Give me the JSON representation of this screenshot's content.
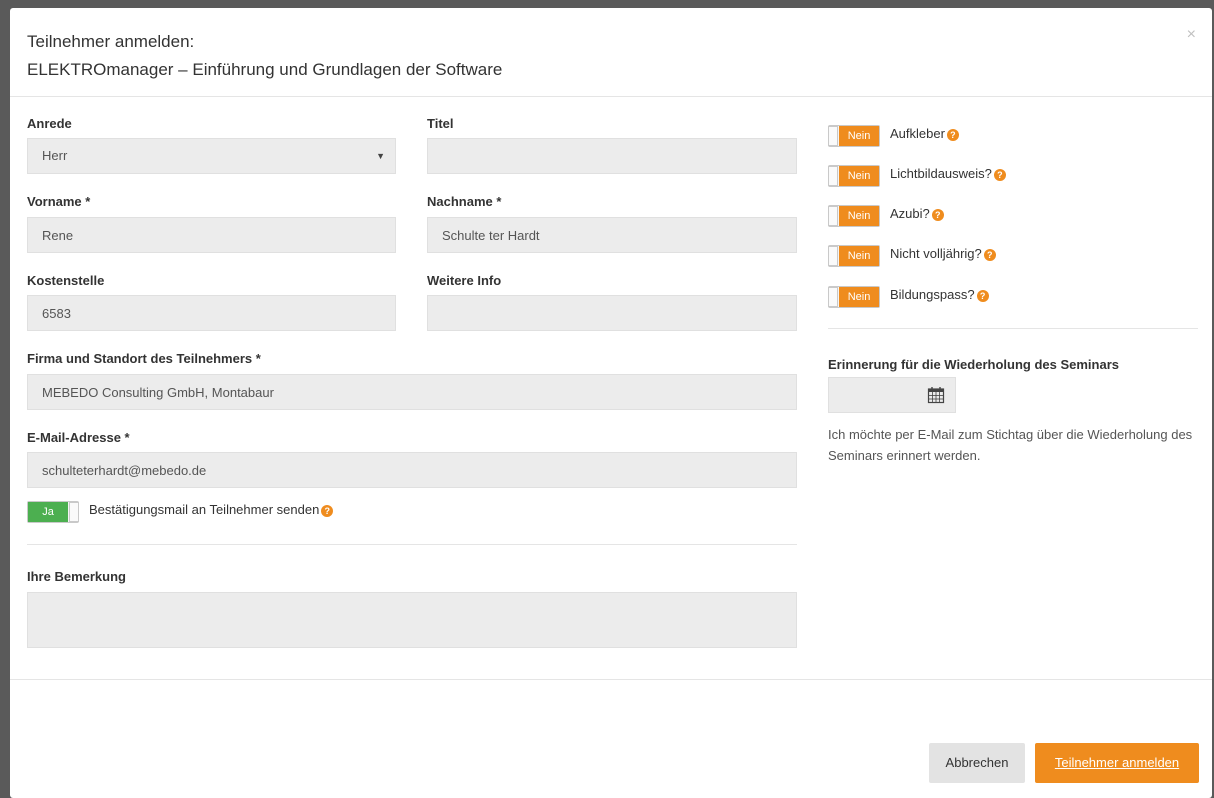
{
  "header": {
    "title_line1": "Teilnehmer anmelden:",
    "title_line2": "ELEKTROmanager – Einführung und Grundlagen der Software",
    "close": "×"
  },
  "form": {
    "anrede": {
      "label": "Anrede",
      "value": "Herr"
    },
    "titel": {
      "label": "Titel",
      "value": ""
    },
    "vorname": {
      "label": "Vorname *",
      "value": "Rene"
    },
    "nachname": {
      "label": "Nachname *",
      "value": "Schulte ter Hardt"
    },
    "kostenstelle": {
      "label": "Kostenstelle",
      "value": "6583"
    },
    "weitere_info": {
      "label": "Weitere Info",
      "value": ""
    },
    "firma": {
      "label": "Firma und Standort des Teilnehmers *",
      "value": "MEBEDO Consulting GmbH, Montabaur"
    },
    "email": {
      "label": "E-Mail-Adresse *",
      "value": "schulteterhardt@mebedo.de"
    },
    "bestaetigung": {
      "toggle": "Ja",
      "label": "Bestätigungsmail an Teilnehmer senden"
    },
    "bemerkung": {
      "label": "Ihre Bemerkung",
      "value": ""
    }
  },
  "options": [
    {
      "toggle": "Nein",
      "label": "Aufkleber"
    },
    {
      "toggle": "Nein",
      "label": "Lichtbildausweis?"
    },
    {
      "toggle": "Nein",
      "label": "Azubi?"
    },
    {
      "toggle": "Nein",
      "label": "Nicht volljährig?"
    },
    {
      "toggle": "Nein",
      "label": "Bildungspass?"
    }
  ],
  "reminder": {
    "label": "Erinnerung für die Wiederholung des Seminars",
    "hint": "Ich möchte per E-Mail zum Stichtag über die Wiederholung des Seminars erinnert werden."
  },
  "footer": {
    "cancel": "Abbrechen",
    "submit": "Teilnehmer anmelden"
  },
  "colors": {
    "accent": "#ef8c1e",
    "success": "#4caf50"
  }
}
